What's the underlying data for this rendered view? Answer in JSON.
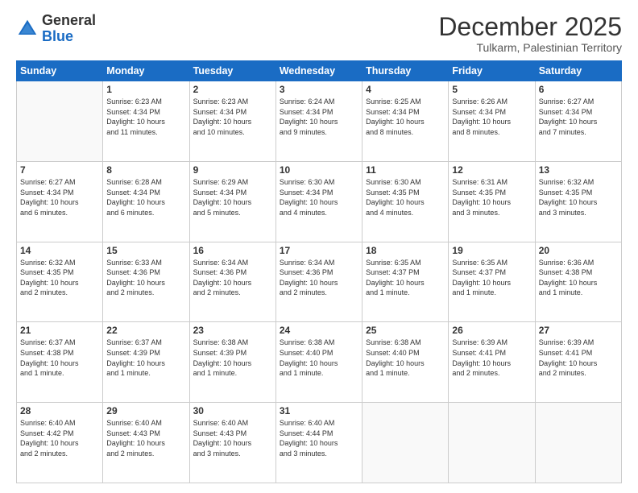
{
  "logo": {
    "general": "General",
    "blue": "Blue"
  },
  "header": {
    "month": "December 2025",
    "location": "Tulkarm, Palestinian Territory"
  },
  "weekdays": [
    "Sunday",
    "Monday",
    "Tuesday",
    "Wednesday",
    "Thursday",
    "Friday",
    "Saturday"
  ],
  "weeks": [
    [
      {
        "day": "",
        "info": ""
      },
      {
        "day": "1",
        "info": "Sunrise: 6:23 AM\nSunset: 4:34 PM\nDaylight: 10 hours\nand 11 minutes."
      },
      {
        "day": "2",
        "info": "Sunrise: 6:23 AM\nSunset: 4:34 PM\nDaylight: 10 hours\nand 10 minutes."
      },
      {
        "day": "3",
        "info": "Sunrise: 6:24 AM\nSunset: 4:34 PM\nDaylight: 10 hours\nand 9 minutes."
      },
      {
        "day": "4",
        "info": "Sunrise: 6:25 AM\nSunset: 4:34 PM\nDaylight: 10 hours\nand 8 minutes."
      },
      {
        "day": "5",
        "info": "Sunrise: 6:26 AM\nSunset: 4:34 PM\nDaylight: 10 hours\nand 8 minutes."
      },
      {
        "day": "6",
        "info": "Sunrise: 6:27 AM\nSunset: 4:34 PM\nDaylight: 10 hours\nand 7 minutes."
      }
    ],
    [
      {
        "day": "7",
        "info": "Sunrise: 6:27 AM\nSunset: 4:34 PM\nDaylight: 10 hours\nand 6 minutes."
      },
      {
        "day": "8",
        "info": "Sunrise: 6:28 AM\nSunset: 4:34 PM\nDaylight: 10 hours\nand 6 minutes."
      },
      {
        "day": "9",
        "info": "Sunrise: 6:29 AM\nSunset: 4:34 PM\nDaylight: 10 hours\nand 5 minutes."
      },
      {
        "day": "10",
        "info": "Sunrise: 6:30 AM\nSunset: 4:34 PM\nDaylight: 10 hours\nand 4 minutes."
      },
      {
        "day": "11",
        "info": "Sunrise: 6:30 AM\nSunset: 4:35 PM\nDaylight: 10 hours\nand 4 minutes."
      },
      {
        "day": "12",
        "info": "Sunrise: 6:31 AM\nSunset: 4:35 PM\nDaylight: 10 hours\nand 3 minutes."
      },
      {
        "day": "13",
        "info": "Sunrise: 6:32 AM\nSunset: 4:35 PM\nDaylight: 10 hours\nand 3 minutes."
      }
    ],
    [
      {
        "day": "14",
        "info": "Sunrise: 6:32 AM\nSunset: 4:35 PM\nDaylight: 10 hours\nand 2 minutes."
      },
      {
        "day": "15",
        "info": "Sunrise: 6:33 AM\nSunset: 4:36 PM\nDaylight: 10 hours\nand 2 minutes."
      },
      {
        "day": "16",
        "info": "Sunrise: 6:34 AM\nSunset: 4:36 PM\nDaylight: 10 hours\nand 2 minutes."
      },
      {
        "day": "17",
        "info": "Sunrise: 6:34 AM\nSunset: 4:36 PM\nDaylight: 10 hours\nand 2 minutes."
      },
      {
        "day": "18",
        "info": "Sunrise: 6:35 AM\nSunset: 4:37 PM\nDaylight: 10 hours\nand 1 minute."
      },
      {
        "day": "19",
        "info": "Sunrise: 6:35 AM\nSunset: 4:37 PM\nDaylight: 10 hours\nand 1 minute."
      },
      {
        "day": "20",
        "info": "Sunrise: 6:36 AM\nSunset: 4:38 PM\nDaylight: 10 hours\nand 1 minute."
      }
    ],
    [
      {
        "day": "21",
        "info": "Sunrise: 6:37 AM\nSunset: 4:38 PM\nDaylight: 10 hours\nand 1 minute."
      },
      {
        "day": "22",
        "info": "Sunrise: 6:37 AM\nSunset: 4:39 PM\nDaylight: 10 hours\nand 1 minute."
      },
      {
        "day": "23",
        "info": "Sunrise: 6:38 AM\nSunset: 4:39 PM\nDaylight: 10 hours\nand 1 minute."
      },
      {
        "day": "24",
        "info": "Sunrise: 6:38 AM\nSunset: 4:40 PM\nDaylight: 10 hours\nand 1 minute."
      },
      {
        "day": "25",
        "info": "Sunrise: 6:38 AM\nSunset: 4:40 PM\nDaylight: 10 hours\nand 1 minute."
      },
      {
        "day": "26",
        "info": "Sunrise: 6:39 AM\nSunset: 4:41 PM\nDaylight: 10 hours\nand 2 minutes."
      },
      {
        "day": "27",
        "info": "Sunrise: 6:39 AM\nSunset: 4:41 PM\nDaylight: 10 hours\nand 2 minutes."
      }
    ],
    [
      {
        "day": "28",
        "info": "Sunrise: 6:40 AM\nSunset: 4:42 PM\nDaylight: 10 hours\nand 2 minutes."
      },
      {
        "day": "29",
        "info": "Sunrise: 6:40 AM\nSunset: 4:43 PM\nDaylight: 10 hours\nand 2 minutes."
      },
      {
        "day": "30",
        "info": "Sunrise: 6:40 AM\nSunset: 4:43 PM\nDaylight: 10 hours\nand 3 minutes."
      },
      {
        "day": "31",
        "info": "Sunrise: 6:40 AM\nSunset: 4:44 PM\nDaylight: 10 hours\nand 3 minutes."
      },
      {
        "day": "",
        "info": ""
      },
      {
        "day": "",
        "info": ""
      },
      {
        "day": "",
        "info": ""
      }
    ]
  ]
}
